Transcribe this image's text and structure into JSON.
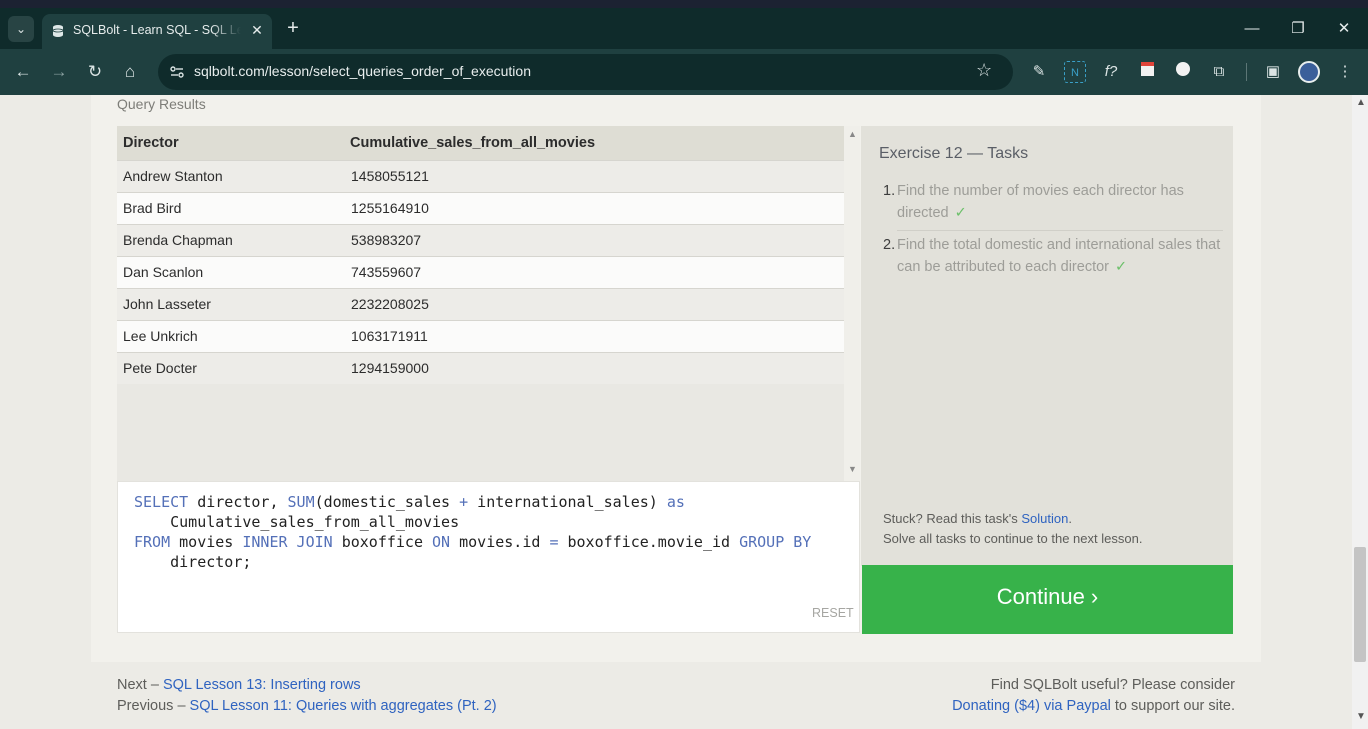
{
  "browser": {
    "tab_title": "SQLBolt - Learn SQL - SQL Lesson",
    "tab_close": "✕",
    "new_tab": "+",
    "url": "sqlbolt.com/lesson/select_queries_order_of_execution",
    "extensions": [
      "f?"
    ]
  },
  "results": {
    "label": "Query Results",
    "columns": [
      "Director",
      "Cumulative_sales_from_all_movies"
    ],
    "rows": [
      [
        "Andrew Stanton",
        "1458055121"
      ],
      [
        "Brad Bird",
        "1255164910"
      ],
      [
        "Brenda Chapman",
        "538983207"
      ],
      [
        "Dan Scanlon",
        "743559607"
      ],
      [
        "John Lasseter",
        "2232208025"
      ],
      [
        "Lee Unkrich",
        "1063171911"
      ],
      [
        "Pete Docter",
        "1294159000"
      ]
    ]
  },
  "editor": {
    "code_line1_kw1": "SELECT",
    "code_line1_a": " director, ",
    "code_line1_kw2": "SUM",
    "code_line1_b": "(domestic_sales ",
    "code_line1_kw3": "+",
    "code_line1_c": " international_sales) ",
    "code_line1_kw4": "as",
    "code_line2": "    Cumulative_sales_from_all_movies",
    "code_line3_kw1": "FROM",
    "code_line3_a": " movies ",
    "code_line3_kw2": "INNER JOIN",
    "code_line3_b": " boxoffice ",
    "code_line3_kw3": "ON",
    "code_line3_c": " movies.id ",
    "code_line3_kw4": "=",
    "code_line3_d": " boxoffice.movie_id ",
    "code_line3_kw5": "GROUP BY",
    "code_line4": "    director;",
    "reset_label": "RESET"
  },
  "tasks": {
    "title": "Exercise 12 — Tasks",
    "items": [
      {
        "num": "1.",
        "text": "Find the number of movies each director has directed",
        "check": "✓"
      },
      {
        "num": "2.",
        "text": "Find the total domestic and international sales that can be attributed to each director",
        "check": "✓"
      }
    ],
    "stuck_prefix": "Stuck? Read this task's ",
    "solution_link": "Solution",
    "stuck_suffix": ".",
    "solve_all": "Solve all tasks to continue to the next lesson."
  },
  "continue_label": "Continue ›",
  "footer": {
    "next_prefix": "Next – ",
    "next_link": "SQL Lesson 13: Inserting rows",
    "prev_prefix": "Previous – ",
    "prev_link": "SQL Lesson 11: Queries with aggregates (Pt. 2)",
    "useful": "Find SQLBolt useful? Please consider",
    "donate_link": "Donating ($4) via Paypal",
    "donate_suffix": " to support our site."
  },
  "colors": {
    "continue_green": "#37b24a",
    "link_blue": "#2f63c0",
    "keyword_blue": "#5470b8",
    "check_green": "#6cc06a"
  }
}
